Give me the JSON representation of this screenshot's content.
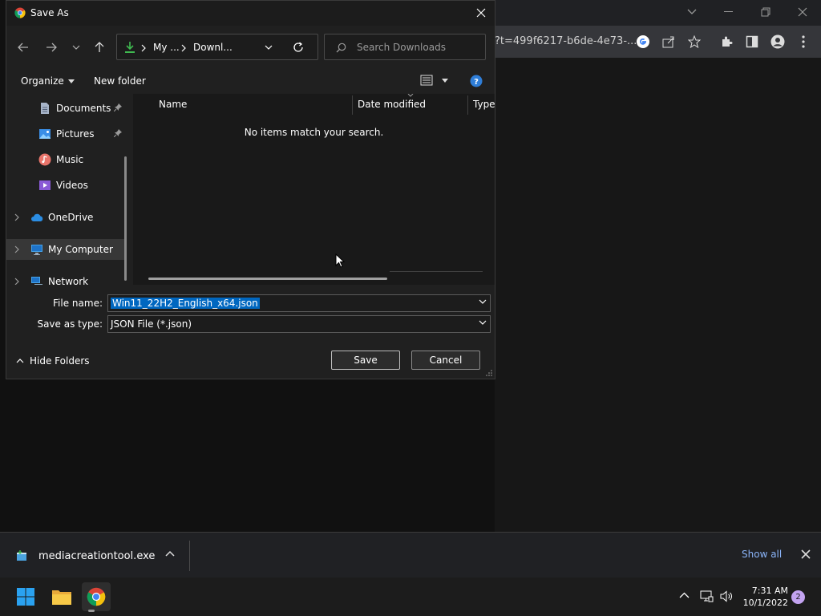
{
  "browser": {
    "url_fragment": "?t=499f6217-b6de-4e73-..."
  },
  "dialog": {
    "title": "Save As",
    "address": {
      "seg1": "My ...",
      "seg2": "Downl..."
    },
    "search_placeholder": "Search Downloads",
    "cmdbar": {
      "organize": "Organize",
      "new_folder": "New folder"
    },
    "nav_items": [
      {
        "label": "Documents"
      },
      {
        "label": "Pictures"
      },
      {
        "label": "Music"
      },
      {
        "label": "Videos"
      },
      {
        "label": "OneDrive"
      },
      {
        "label": "My Computer"
      },
      {
        "label": "Network"
      }
    ],
    "columns": {
      "name": "Name",
      "date_modified": "Date modified",
      "type": "Type"
    },
    "empty_message": "No items match your search.",
    "file_name_label": "File name:",
    "file_name_value": "Win11_22H2_English_x64.json",
    "save_type_label": "Save as type:",
    "save_type_value": "JSON File (*.json)",
    "hide_folders": "Hide Folders",
    "save_btn": "Save",
    "cancel_btn": "Cancel"
  },
  "shelf": {
    "download_name": "mediacreationtool.exe",
    "show_all": "Show all"
  },
  "taskbar": {
    "time": "7:31 AM",
    "date": "10/1/2022",
    "notification_count": "2"
  },
  "colors": {
    "accent": "#0067c0",
    "link": "#8ab4f8"
  }
}
